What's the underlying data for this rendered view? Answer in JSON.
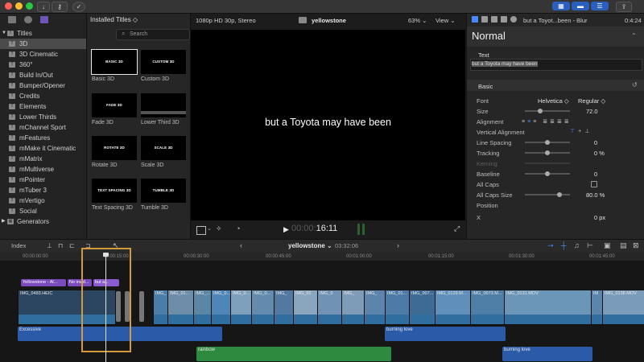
{
  "toolbar": {
    "colors": {
      "close": "#fe5f57",
      "min": "#febc2e",
      "max": "#28c840",
      "accent": "#2b5fbd"
    }
  },
  "sidebar": {
    "items": [
      {
        "label": "Titles",
        "icon": "film-icon"
      },
      {
        "label": "3D"
      },
      {
        "label": "3D Cinematic"
      },
      {
        "label": "360°"
      },
      {
        "label": "Build In/Out"
      },
      {
        "label": "Bumper/Opener"
      },
      {
        "label": "Credits"
      },
      {
        "label": "Elements"
      },
      {
        "label": "Lower Thirds"
      },
      {
        "label": "mChannel Sport"
      },
      {
        "label": "mFeatures"
      },
      {
        "label": "mMake it Cinematic"
      },
      {
        "label": "mMatrix"
      },
      {
        "label": "mMultiverse"
      },
      {
        "label": "mPointer"
      },
      {
        "label": "mTuber 3"
      },
      {
        "label": "mVertigo"
      },
      {
        "label": "Social"
      },
      {
        "label": "Generators"
      }
    ]
  },
  "browser": {
    "header": "Installed Titles ◇",
    "search_placeholder": "Search",
    "titles": [
      {
        "thumb": "BASIC 3D",
        "label": "Basic 3D",
        "selected": true
      },
      {
        "thumb": "CUSTOM 3D",
        "label": "Custom 3D"
      },
      {
        "thumb": "FADE 3D",
        "label": "Fade 3D"
      },
      {
        "thumb": "",
        "label": "Lower Third 3D"
      },
      {
        "thumb": "ROTATE 3D",
        "label": "Rotate 3D"
      },
      {
        "thumb": "SCALE 3D",
        "label": "Scale 3D"
      },
      {
        "thumb": "TEXT SPACING 3D",
        "label": "Text Spacing 3D"
      },
      {
        "thumb": "TUMBLE 3D",
        "label": "Tumble 3D"
      }
    ]
  },
  "viewer": {
    "format": "1080p HD 30p, Stereo",
    "project": "yellowstone",
    "zoom": "63% ⌄",
    "view": "View ⌄",
    "overlay_text": "but a Toyota may have been",
    "timecode_dim": "00:00:",
    "timecode": "16:11"
  },
  "inspector": {
    "clip_title": "but a Toyot...been - Blur",
    "duration": "0:4:24",
    "preset": "Normal",
    "text_section": "Text",
    "text_value": "but a Toyota may have been",
    "basic_section": "Basic",
    "rows": [
      {
        "label": "Font",
        "value": "Helvetica ◇",
        "value2": "Regular ◇"
      },
      {
        "label": "Size",
        "value": "72.0"
      },
      {
        "label": "Alignment",
        "value": ""
      },
      {
        "label": "Vertical Alignment",
        "value": ""
      },
      {
        "label": "Line Spacing",
        "value": "0"
      },
      {
        "label": "Tracking",
        "value": "0 %"
      },
      {
        "label": "Kerning",
        "value": ""
      },
      {
        "label": "Baseline",
        "value": "0"
      },
      {
        "label": "All Caps",
        "value": ""
      },
      {
        "label": "All Caps Size",
        "value": "80.0 %"
      },
      {
        "label": "Position",
        "value": ""
      },
      {
        "label": "X",
        "value": "0 px"
      }
    ]
  },
  "timeline": {
    "index_label": "Index",
    "project": "yellowstone ⌄",
    "duration": "03:32:06",
    "ruler": [
      "00:00:00:00",
      "00:00:15:00",
      "00:00:30:00",
      "00:00:45:00",
      "00:01:00:00",
      "00:01:15:00",
      "00:01:30:00",
      "00:01:45:00"
    ],
    "title_clips": [
      "Yellowstone - Al...",
      "No invid...",
      "but a..."
    ],
    "video_clips": [
      "IMG_0483.HEIC",
      "IMG_01...",
      "IMG_...",
      "IMG_0...",
      "IMG_0...",
      "IMG_0...",
      "IMG_01...",
      "IMG_0...",
      "IMG_007...",
      "IMG_0129.M...",
      "IMG_0073.M...",
      "IMG_0131.MOV",
      "IMG_0138.MOV"
    ],
    "audio_clips": [
      "Excessive",
      "burning love",
      "rainbow",
      "burning love"
    ]
  }
}
